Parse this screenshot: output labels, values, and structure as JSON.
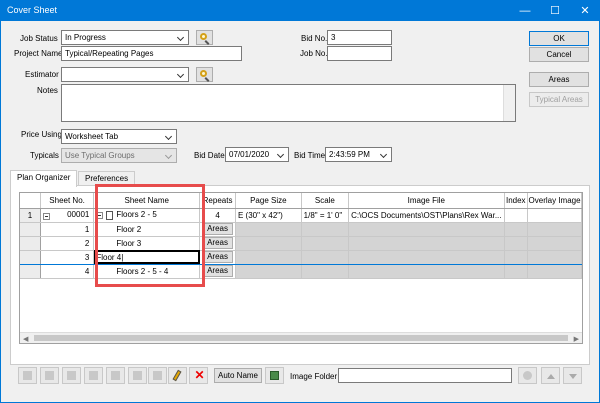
{
  "window": {
    "title": "Cover Sheet",
    "controls": {
      "minimize": "—",
      "maximize": "☐",
      "close": "✕"
    }
  },
  "form": {
    "job_status_label": "Job Status",
    "job_status_value": "In Progress",
    "project_name_label": "Project Name",
    "project_name_value": "Typical/Repeating Pages",
    "estimator_label": "Estimator",
    "estimator_value": "",
    "notes_label": "Notes",
    "notes_value": "",
    "bid_no_label": "Bid No.",
    "bid_no_value": "3",
    "job_no_label": "Job No.",
    "job_no_value": "",
    "price_using_label": "Price Using",
    "price_using_value": "Worksheet Tab",
    "typicals_label": "Typicals",
    "typicals_value": "Use Typical Groups",
    "bid_date_label": "Bid Date",
    "bid_date_value": "07/01/2020",
    "bid_time_label": "Bid Time",
    "bid_time_value": "2:43:59 PM"
  },
  "buttons": {
    "ok": "OK",
    "cancel": "Cancel",
    "areas": "Areas",
    "typical_areas": "Typical Areas"
  },
  "tabs": [
    {
      "label": "Plan Organizer",
      "active": true
    },
    {
      "label": "Preferences",
      "active": false
    }
  ],
  "grid": {
    "columns": [
      "",
      "Sheet No.",
      "Sheet Name",
      "Repeats",
      "Page Size",
      "Scale",
      "Image File",
      "Index",
      "Overlay Image"
    ],
    "rows": [
      {
        "rowhdr": "1",
        "sheet_no": "00001",
        "sheet_name": "Floors 2 - 5",
        "repeats": "4",
        "page_size": "E (30\" x 42\")",
        "scale": "1/8\" = 1' 0\"",
        "image_file": "C:\\OCS Documents\\OST\\Plans\\Rex War...",
        "index": "",
        "overlay": ""
      },
      {
        "rowhdr": "",
        "sheet_no": "1",
        "sheet_name": "Floor 2",
        "repeats": "Areas"
      },
      {
        "rowhdr": "",
        "sheet_no": "2",
        "sheet_name": "Floor 3",
        "repeats": "Areas"
      },
      {
        "rowhdr": "",
        "sheet_no": "3",
        "sheet_name": "Floor 4",
        "repeats": "Areas"
      },
      {
        "rowhdr": "",
        "sheet_no": "4",
        "sheet_name": "Floors 2 - 5 - 4",
        "repeats": "Areas"
      }
    ]
  },
  "bottom_toolbar": {
    "auto_name": "Auto Name",
    "image_folder_label": "Image Folder",
    "image_folder_value": ""
  },
  "colors": {
    "titlebar": "#0078d7",
    "highlight": "#e74c4c",
    "selection_line": "#0078d7"
  }
}
